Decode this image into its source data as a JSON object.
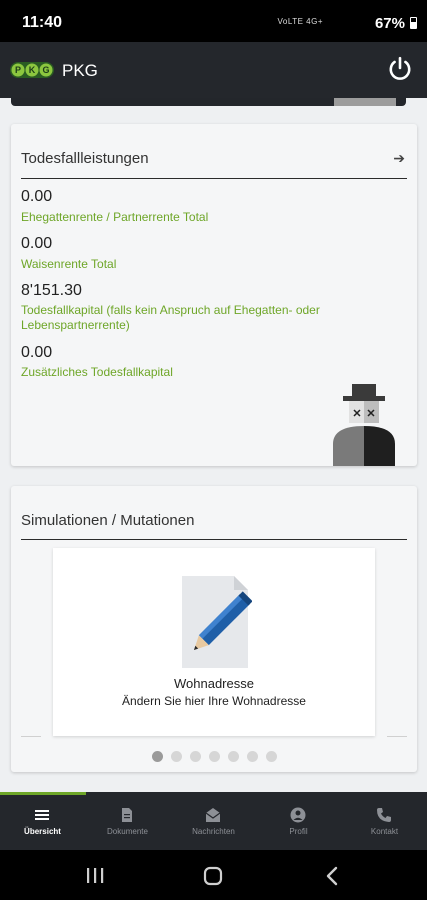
{
  "status_bar": {
    "time": "11:40",
    "network": "VoLTE 4G+",
    "battery": "67%"
  },
  "app_bar": {
    "logo_text": "PKG",
    "title": "PKG",
    "power_icon": "power-icon"
  },
  "death_benefits": {
    "title": "Todesfallleistungen",
    "arrow_icon": "arrow-right-icon",
    "items": [
      {
        "value": "0.00",
        "label": "Ehegattenrente / Partnerrente Total"
      },
      {
        "value": "0.00",
        "label": "Waisenrente Total"
      },
      {
        "value": "8'151.30",
        "label": "Todesfallkapital (falls kein Anspruch auf Ehegatten- oder Lebenspartnerrente)"
      },
      {
        "value": "0.00",
        "label": "Zusätzliches Todesfallkapital"
      }
    ]
  },
  "simulations": {
    "title": "Simulationen / Mutationen",
    "slide": {
      "icon": "document-edit-icon",
      "title": "Wohnadresse",
      "subtitle": "Ändern Sie hier Ihre Wohnadresse"
    },
    "dots_total": 7,
    "dots_active_index": 0
  },
  "bottom_nav": {
    "active_index": 0,
    "items": [
      {
        "label": "Übersicht",
        "icon": "menu-icon"
      },
      {
        "label": "Dokumente",
        "icon": "document-icon"
      },
      {
        "label": "Nachrichten",
        "icon": "envelope-icon"
      },
      {
        "label": "Profil",
        "icon": "person-icon"
      },
      {
        "label": "Kontakt",
        "icon": "phone-icon"
      }
    ]
  },
  "colors": {
    "accent": "#6ea628",
    "appbar": "#24272c",
    "card": "#f5f6f7"
  }
}
